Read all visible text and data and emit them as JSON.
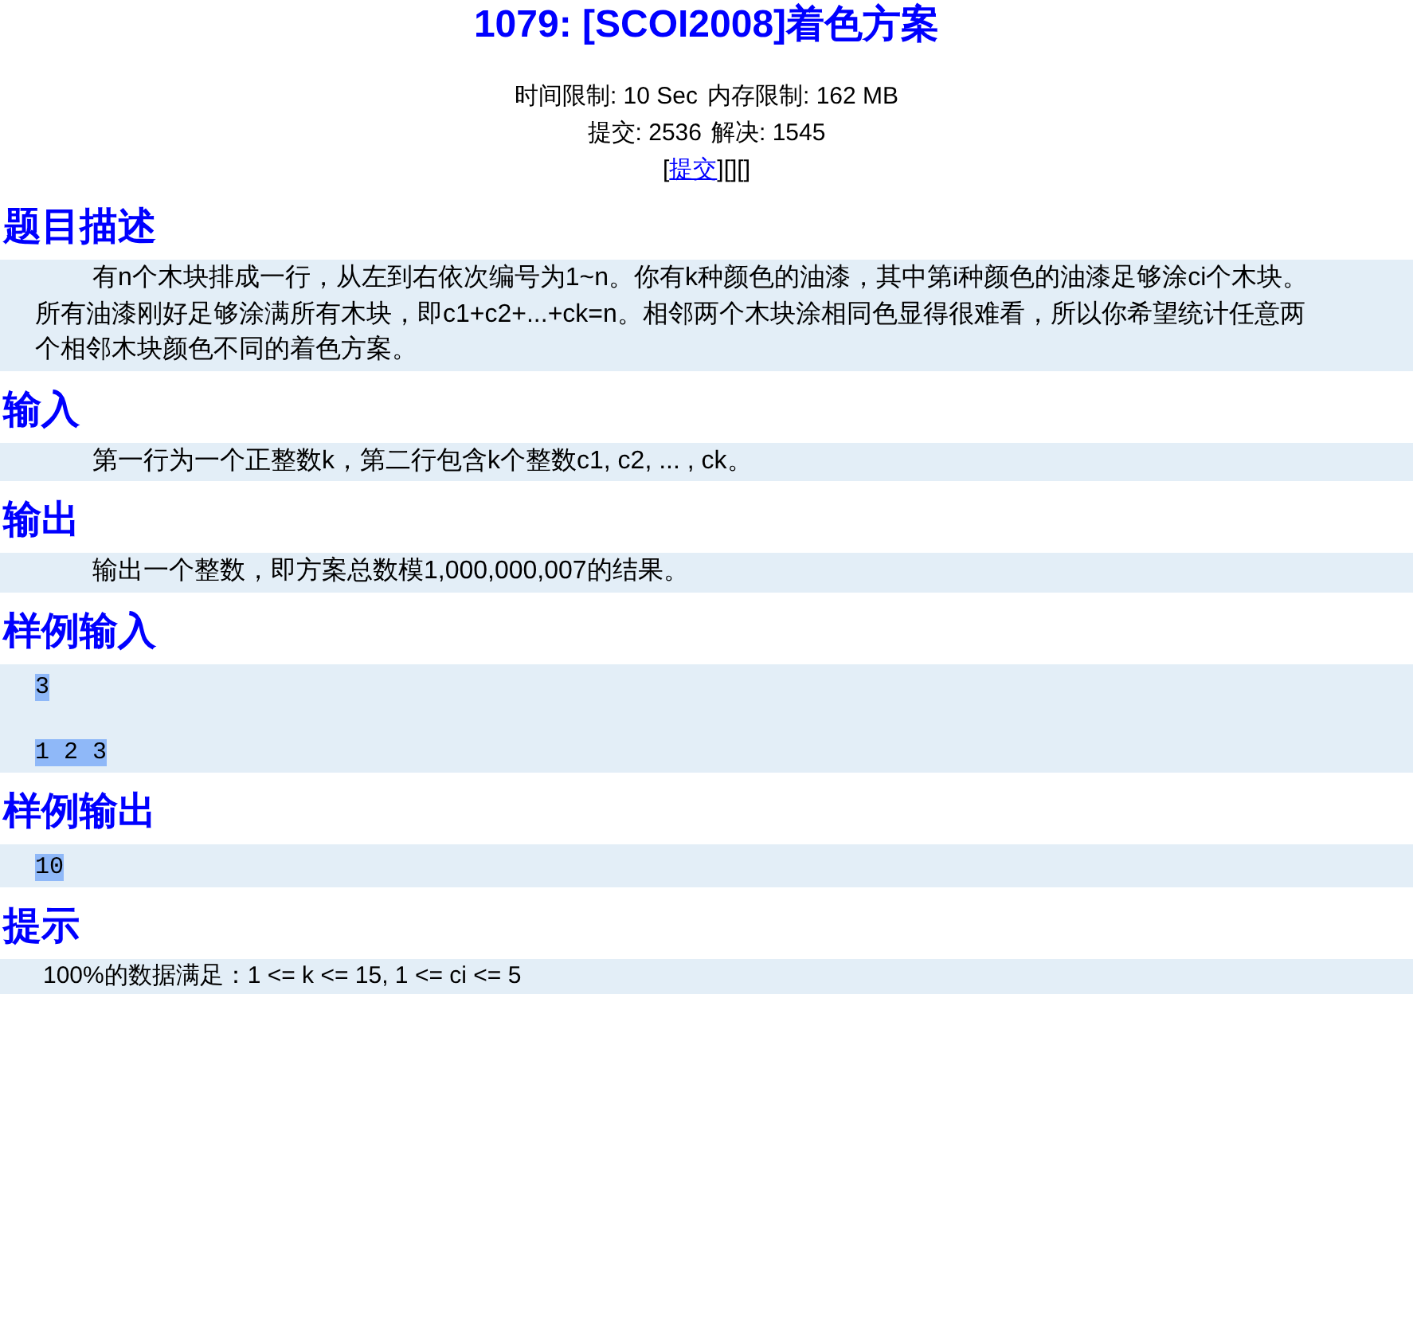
{
  "title": "1079: [SCOI2008]着色方案",
  "meta": [
    {
      "label": "时间限制:",
      "value": "10 Sec"
    },
    {
      "label": "内存限制:",
      "value": "162 MB"
    },
    {
      "label": "提交:",
      "value": "2536"
    },
    {
      "label": "解决:",
      "value": "1545"
    }
  ],
  "links": {
    "open": "[",
    "submit": "提交",
    "close": "][][]"
  },
  "sections": [
    {
      "heading": "题目描述",
      "kind": "text",
      "lines": [
        "有n个木块排成一行，从左到右依次编号为1~n。你有k种颜色的油漆，其中第i种颜色的油漆足够涂ci个木块。",
        "所有油漆刚好足够涂满所有木块，即c1+c2+...+ck=n。相邻两个木块涂相同色显得很难看，所以你希望统计任意两",
        "个相邻木块颜色不同的着色方案。"
      ]
    },
    {
      "heading": "输入",
      "kind": "text",
      "lines": [
        "第一行为一个正整数k，第二行包含k个整数c1, c2, ... , ck。"
      ]
    },
    {
      "heading": "输出",
      "kind": "text",
      "lines": [
        "输出一个整数，即方案总数模1,000,000,007的结果。"
      ]
    },
    {
      "heading": "样例输入",
      "kind": "sample",
      "lines": [
        "3",
        "1 2 3"
      ]
    },
    {
      "heading": "样例输出",
      "kind": "sample",
      "lines": [
        "10"
      ]
    },
    {
      "heading": "提示",
      "kind": "hint",
      "lines": [
        "100%的数据满足：1 <= k <= 15, 1 <= ci <= 5"
      ]
    }
  ]
}
